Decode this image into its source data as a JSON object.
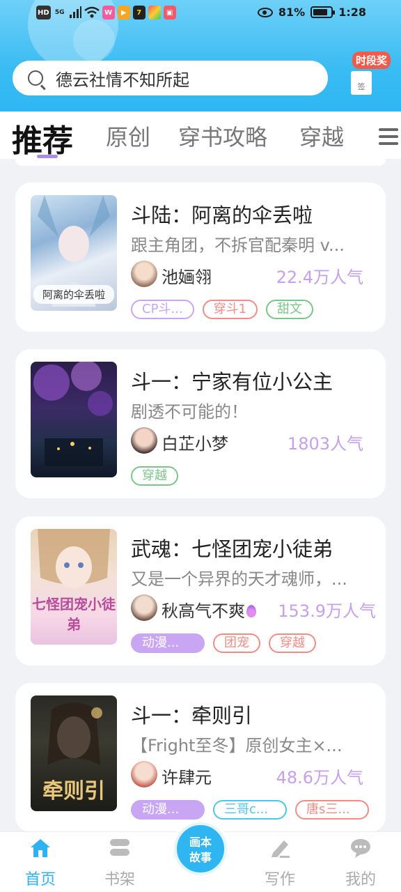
{
  "status_bar": {
    "left_icons": [
      "HD",
      "5G",
      "signal-icon",
      "wifi-icon",
      "app-icon",
      "video-icon",
      "app-icon",
      "app-icon",
      "book-icon"
    ],
    "battery": "81%",
    "time": "1:28"
  },
  "search": {
    "placeholder": "德云社情不知所起"
  },
  "reward": {
    "badge": "时段奖",
    "box_label": "签"
  },
  "tabs": [
    {
      "label": "推荐",
      "active": true
    },
    {
      "label": "原创",
      "active": false
    },
    {
      "label": "穿书攻略",
      "active": false
    },
    {
      "label": "穿越",
      "active": false
    }
  ],
  "books": [
    {
      "cover_text": "阿离的伞丢啦",
      "title": "斗陆：阿离的伞丢啦",
      "desc": "跟主角团，不拆官配秦明 v...",
      "author": "池婳翎",
      "popularity": "22.4万人气",
      "hot": false,
      "tags": [
        {
          "label": "CP斗...",
          "style": "outline",
          "color": "#c9a6f4"
        },
        {
          "label": "穿斗1",
          "style": "outline",
          "color": "#ef8d86"
        },
        {
          "label": "甜文",
          "style": "outline",
          "color": "#7cc68a"
        }
      ]
    },
    {
      "cover_text": "",
      "title": "斗一：宁家有位小公主",
      "desc": "剧透不可能的！",
      "author": "白芷小梦",
      "popularity": "1803人气",
      "hot": false,
      "tags": [
        {
          "label": "穿越",
          "style": "outline",
          "color": "#7cc68a"
        }
      ]
    },
    {
      "cover_text": "七怪团宠小徒弟",
      "title": "武魂：七怪团宠小徒弟",
      "desc": "又是一个异界的天才魂师，...",
      "author": "秋高气不爽",
      "popularity": "153.9万人气",
      "hot": true,
      "tags": [
        {
          "label": "动漫...",
          "style": "filled",
          "color": "#c9a6f4"
        },
        {
          "label": "团宠",
          "style": "outline",
          "color": "#ef8d86"
        },
        {
          "label": "穿越",
          "style": "outline",
          "color": "#ef8d86"
        }
      ]
    },
    {
      "cover_text": "牵则引",
      "title": "斗一：牵则引",
      "desc": "【Fright至冬】原创女主×...",
      "author": "许肆元",
      "popularity": "48.6万人气",
      "hot": false,
      "tags": [
        {
          "label": "动漫...",
          "style": "filled",
          "color": "#c9a6f4"
        },
        {
          "label": "三哥c...",
          "style": "outline",
          "color": "#4fc6e8"
        },
        {
          "label": "唐s三...",
          "style": "outline",
          "color": "#ef8d86"
        }
      ]
    }
  ],
  "bottom_nav": {
    "home": "首页",
    "shelf": "书架",
    "center": [
      "画本",
      "故事"
    ],
    "write": "写作",
    "me": "我的"
  },
  "colors": {
    "accent": "#2fb6f2",
    "popularity": "#c6a0ee",
    "tab_indicator": "#a98bf0"
  }
}
